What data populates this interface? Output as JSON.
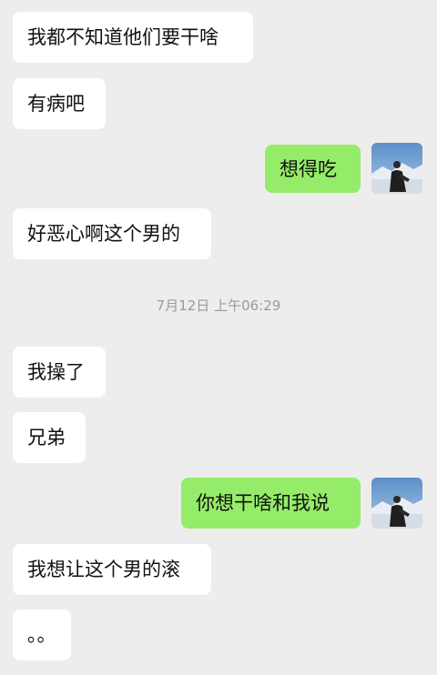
{
  "messages": [
    {
      "side": "left",
      "text": "我都不知道他们要干啥"
    },
    {
      "side": "left",
      "text": "有病吧"
    },
    {
      "side": "right",
      "text": "想得吃"
    },
    {
      "side": "left",
      "text": "好恶心啊这个男的"
    },
    {
      "side": "left",
      "text": "我操了"
    },
    {
      "side": "left",
      "text": "兄弟"
    },
    {
      "side": "right",
      "text": "你想干啥和我说"
    },
    {
      "side": "left",
      "text": "我想让这个男的滚"
    },
    {
      "side": "left",
      "text": "。。"
    }
  ],
  "timestamp": "7月12日 上午06:29",
  "colors": {
    "background": "#ededed",
    "incoming_bubble": "#ffffff",
    "outgoing_bubble": "#95ec69",
    "timestamp_text": "#9a9a9a"
  },
  "avatar_icon": "user-avatar-snow-mountain-photo"
}
